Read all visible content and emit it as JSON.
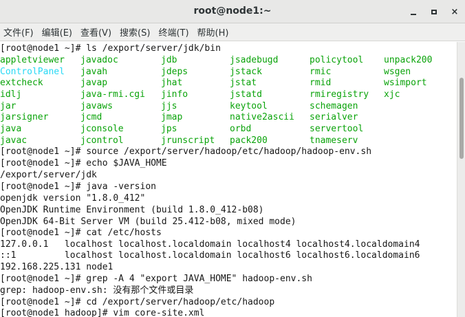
{
  "window": {
    "title": "root@node1:~",
    "controls": {
      "minimize": "minimize-icon",
      "maximize": "maximize-icon",
      "close": "×"
    }
  },
  "menu": [
    "文件(F)",
    "编辑(E)",
    "查看(V)",
    "搜索(S)",
    "终端(T)",
    "帮助(H)"
  ],
  "colors": {
    "green": "#0aa30a",
    "cyan": "#29d9f5",
    "text": "#171717"
  },
  "terminal": {
    "line0": "[root@node1 ~]# ls /export/server/jdk/bin",
    "grid": [
      [
        "appletviewer",
        "javadoc",
        "jdb",
        "jsadebugd",
        "policytool",
        "unpack200"
      ],
      [
        "ControlPanel",
        "javah",
        "jdeps",
        "jstack",
        "rmic",
        "wsgen"
      ],
      [
        "extcheck",
        "javap",
        "jhat",
        "jstat",
        "rmid",
        "wsimport"
      ],
      [
        "idlj",
        "java-rmi.cgi",
        "jinfo",
        "jstatd",
        "rmiregistry",
        "xjc"
      ],
      [
        "jar",
        "javaws",
        "jjs",
        "keytool",
        "schemagen",
        ""
      ],
      [
        "jarsigner",
        "jcmd",
        "jmap",
        "native2ascii",
        "serialver",
        ""
      ],
      [
        "java",
        "jconsole",
        "jps",
        "orbd",
        "servertool",
        ""
      ],
      [
        "javac",
        "jcontrol",
        "jrunscript",
        "pack200",
        "tnameserv",
        ""
      ]
    ],
    "line9": "[root@node1 ~]# source /export/server/hadoop/etc/hadoop/hadoop-env.sh",
    "line10": "[root@node1 ~]# echo $JAVA_HOME",
    "line11": "/export/server/jdk",
    "line12": "[root@node1 ~]# java -version",
    "line13": "openjdk version \"1.8.0_412\"",
    "line14": "OpenJDK Runtime Environment (build 1.8.0_412-b08)",
    "line15": "OpenJDK 64-Bit Server VM (build 25.412-b08, mixed mode)",
    "line16": "[root@node1 ~]# cat /etc/hosts",
    "line17": "127.0.0.1   localhost localhost.localdomain localhost4 localhost4.localdomain4",
    "line18": "::1         localhost localhost.localdomain localhost6 localhost6.localdomain6",
    "line19": "192.168.225.131 node1",
    "line20": "[root@node1 ~]# grep -A 4 \"export JAVA_HOME\" hadoop-env.sh",
    "line21": "grep: hadoop-env.sh: 没有那个文件或目录",
    "line22": "[root@node1 ~]# cd /export/server/hadoop/etc/hadoop",
    "line23": "[root@node1 hadoop]# vim core-site.xml"
  }
}
